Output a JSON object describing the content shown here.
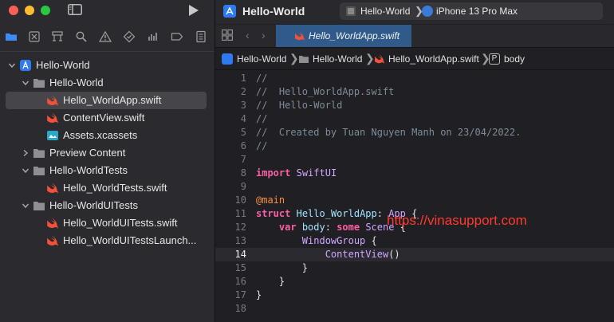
{
  "window": {
    "title": "Hello-World"
  },
  "scheme": {
    "target": "Hello-World",
    "device": "iPhone 13 Pro Max"
  },
  "tabs": [
    {
      "label": "Hello_WorldApp.swift",
      "icon": "swift-file-icon",
      "active": true
    }
  ],
  "jumpbar": [
    {
      "label": "Hello-World",
      "icon": "project-icon"
    },
    {
      "label": "Hello-World",
      "icon": "folder-icon"
    },
    {
      "label": "Hello_WorldApp.swift",
      "icon": "swift-file-icon"
    },
    {
      "label": "body",
      "icon": "property-icon",
      "icon_text": "P"
    }
  ],
  "navigator": {
    "icons": [
      "folder-icon",
      "source-control-icon",
      "symbol-icon",
      "search-icon",
      "issue-icon",
      "test-icon",
      "debug-icon",
      "breakpoint-icon",
      "report-icon"
    ]
  },
  "tree": [
    {
      "label": "Hello-World",
      "kind": "project",
      "level": 0,
      "expanded": true
    },
    {
      "label": "Hello-World",
      "kind": "folder",
      "level": 1,
      "expanded": true
    },
    {
      "label": "Hello_WorldApp.swift",
      "kind": "swift",
      "level": 2,
      "selected": true
    },
    {
      "label": "ContentView.swift",
      "kind": "swift",
      "level": 2
    },
    {
      "label": "Assets.xcassets",
      "kind": "assets",
      "level": 2
    },
    {
      "label": "Preview Content",
      "kind": "folder",
      "level": 1,
      "expanded": false
    },
    {
      "label": "Hello-WorldTests",
      "kind": "folder",
      "level": 1,
      "expanded": true
    },
    {
      "label": "Hello_WorldTests.swift",
      "kind": "swift",
      "level": 2
    },
    {
      "label": "Hello-WorldUITests",
      "kind": "folder",
      "level": 1,
      "expanded": true
    },
    {
      "label": "Hello_WorldUITests.swift",
      "kind": "swift",
      "level": 2
    },
    {
      "label": "Hello_WorldUITestsLaunch...",
      "kind": "swift",
      "level": 2
    }
  ],
  "code": {
    "current_line": 14,
    "lines": [
      {
        "n": "1",
        "text": "//"
      },
      {
        "n": "2",
        "text": "//  Hello_WorldApp.swift"
      },
      {
        "n": "3",
        "text": "//  Hello-World"
      },
      {
        "n": "4",
        "text": "//"
      },
      {
        "n": "5",
        "text": "//  Created by Tuan Nguyen Manh on 23/04/2022."
      },
      {
        "n": "6",
        "text": "//"
      },
      {
        "n": "7",
        "text": ""
      },
      {
        "n": "8",
        "text": "import SwiftUI"
      },
      {
        "n": "9",
        "text": ""
      },
      {
        "n": "10",
        "text": "@main"
      },
      {
        "n": "11",
        "text": "struct Hello_WorldApp: App {"
      },
      {
        "n": "12",
        "text": "    var body: some Scene {"
      },
      {
        "n": "13",
        "text": "        WindowGroup {"
      },
      {
        "n": "14",
        "text": "            ContentView()"
      },
      {
        "n": "15",
        "text": "        }"
      },
      {
        "n": "16",
        "text": "    }"
      },
      {
        "n": "17",
        "text": "}"
      },
      {
        "n": "18",
        "text": ""
      }
    ]
  },
  "watermark": "https://vinasupport.com",
  "colors": {
    "accent": "#2f7af0",
    "swift": "#f05138",
    "keyword": "#fc5fa3",
    "comment": "#7f8c98"
  }
}
